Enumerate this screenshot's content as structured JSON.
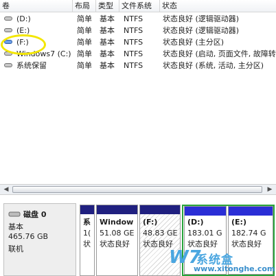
{
  "columns": [
    "卷",
    "布局",
    "类型",
    "文件系统",
    "状态"
  ],
  "volumes": [
    {
      "name": "(D:)",
      "layout": "简单",
      "type": "基本",
      "fs": "NTFS",
      "status": "状态良好 (逻辑驱动器)"
    },
    {
      "name": "(E:)",
      "layout": "简单",
      "type": "基本",
      "fs": "NTFS",
      "status": "状态良好 (逻辑驱动器)"
    },
    {
      "name": "(F:)",
      "layout": "简单",
      "type": "基本",
      "fs": "NTFS",
      "status": "状态良好 (主分区)"
    },
    {
      "name": "Windows7 (C:)",
      "layout": "简单",
      "type": "基本",
      "fs": "NTFS",
      "status": "状态良好 (启动, 页面文件, 故障转"
    },
    {
      "name": "系统保留",
      "layout": "简单",
      "type": "基本",
      "fs": "NTFS",
      "status": "状态良好 (系统, 活动, 主分区)"
    }
  ],
  "disk": {
    "name": "磁盘 0",
    "type": "基本",
    "size": "465.76 GB",
    "state": "联机"
  },
  "partitions": [
    {
      "label": "系",
      "size": "1(",
      "status": "状"
    },
    {
      "label": "Window",
      "size": "51.08 GE",
      "status": "状态良好"
    },
    {
      "label": "(F:)",
      "size": "48.83 GE",
      "status": "状态良好"
    },
    {
      "label": "(D:)",
      "size": "183.01 G",
      "status": "状态良好"
    },
    {
      "label": "(E:)",
      "size": "182.74 G",
      "status": "状态良好"
    }
  ],
  "watermark": {
    "logo": "W7",
    "cn": "系统盒",
    "url": "www.xitonghe.com"
  },
  "scroll": {
    "left": "◀",
    "right": "▶"
  }
}
